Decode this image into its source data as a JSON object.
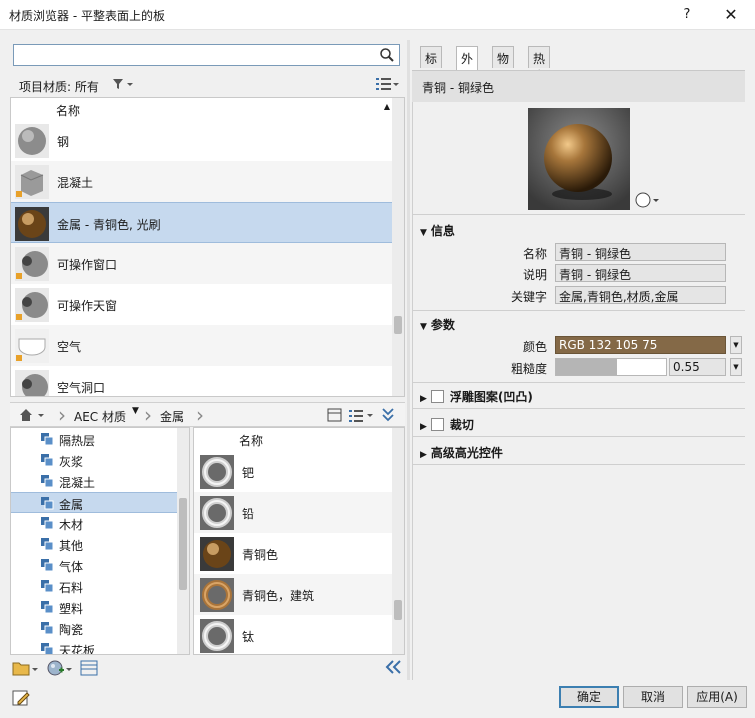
{
  "window": {
    "title": "材质浏览器 - 平整表面上的板",
    "help": "?",
    "close": "✕"
  },
  "search": {
    "value": "",
    "placeholder": ""
  },
  "filter": {
    "label": "项目材质: 所有"
  },
  "materials": {
    "header": "名称",
    "rows": [
      {
        "name": "钢",
        "thumb": "steel"
      },
      {
        "name": "混凝土",
        "thumb": "concrete"
      },
      {
        "name": "金属 - 青铜色, 光刷",
        "thumb": "bronze",
        "selected": true
      },
      {
        "name": "可操作窗口",
        "thumb": "glass"
      },
      {
        "name": "可操作天窗",
        "thumb": "glass"
      },
      {
        "name": "空气",
        "thumb": "air"
      },
      {
        "name": "空气洞口",
        "thumb": "glass"
      }
    ]
  },
  "breadcrumb": {
    "items": [
      "AEC 材质",
      "金属"
    ]
  },
  "tree": {
    "items": [
      "隔热层",
      "灰浆",
      "混凝土",
      "金属",
      "木材",
      "其他",
      "气体",
      "石料",
      "塑料",
      "陶瓷",
      "天花板"
    ],
    "selected_index": 3
  },
  "library": {
    "header": "名称",
    "rows": [
      {
        "name": "钯",
        "thumb": "silver"
      },
      {
        "name": "铅",
        "thumb": "silver"
      },
      {
        "name": "青铜色",
        "thumb": "bronze"
      },
      {
        "name": "青铜色，建筑",
        "thumb": "bronze-light"
      },
      {
        "name": "钛",
        "thumb": "silver"
      }
    ]
  },
  "tabs": [
    "标识",
    "外观",
    "物理",
    "热度"
  ],
  "active_tab": "外观",
  "asset": {
    "title": "青铜 - 铜绿色"
  },
  "info": {
    "header": "信息",
    "name_label": "名称",
    "name_value": "青铜 - 铜绿色",
    "desc_label": "说明",
    "desc_value": "青铜 - 铜绿色",
    "kw_label": "关键字",
    "kw_value": "金属,青铜色,材质,金属"
  },
  "params": {
    "header": "参数",
    "color_label": "颜色",
    "color_value": "RGB 132 105 75",
    "rough_label": "粗糙度",
    "rough_value": "0.55",
    "rough_fraction": 0.55
  },
  "sections": {
    "relief": "浮雕图案(凹凸)",
    "cutout": "裁切",
    "highlight": "高级高光控件"
  },
  "buttons": {
    "ok": "确定",
    "cancel": "取消",
    "apply": "应用(A)"
  },
  "colors": {
    "bronze": "#846947",
    "selection": "#c6d9ee",
    "primary_border": "#3c7fb1"
  }
}
